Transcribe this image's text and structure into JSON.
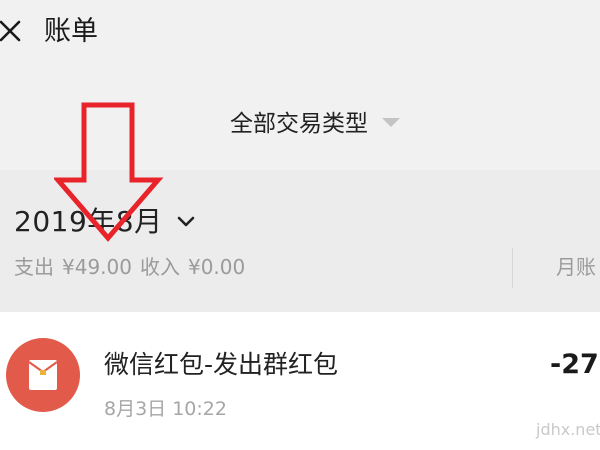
{
  "header": {
    "title": "账单",
    "close_icon": "close-icon"
  },
  "filter": {
    "label": "全部交易类型",
    "caret_icon": "caret-down-icon"
  },
  "month": {
    "label": "2019年8月",
    "chevron_icon": "chevron-down-icon",
    "expense_label": "支出",
    "expense_value": "¥49.00",
    "income_label": "收入",
    "income_value": "¥0.00",
    "stats_label": "月账"
  },
  "transactions": [
    {
      "title": "微信红包-发出群红包",
      "time": "8月3日 10:22",
      "amount": "-27",
      "icon": "red-envelope-icon"
    }
  ],
  "watermark": "jdhx.net",
  "colors": {
    "background": "#f1f1f1",
    "month_band": "#ececec",
    "list_bg": "#ffffff",
    "red_envelope": "#e25a4a",
    "annotation_arrow": "#e8242a"
  }
}
